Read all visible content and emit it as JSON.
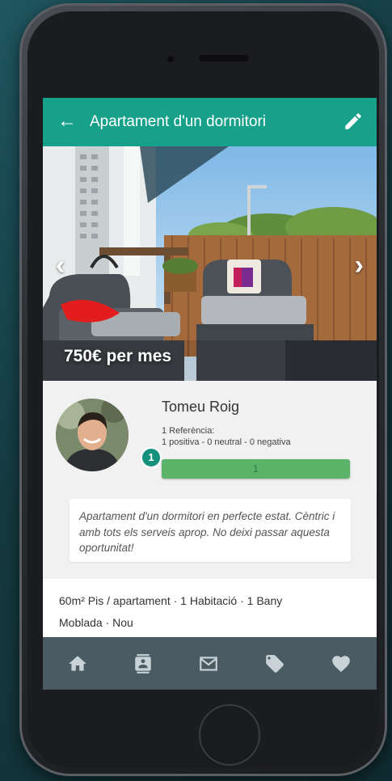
{
  "app_bar": {
    "back_icon": "arrow-left-icon",
    "title": "Apartament d'un dormitori",
    "edit_icon": "pencil-icon"
  },
  "listing": {
    "price": "750€ per mes",
    "prev_icon": "chevron-left-icon",
    "next_icon": "chevron-right-icon"
  },
  "owner": {
    "name": "Tomeu Roig",
    "badge": "1",
    "references_label": "1 Referència:",
    "references_detail": "1 positiva  - 0 neutral  - 0 negativa",
    "rating_bar_label": "1",
    "rating_bar_fill": 1.0
  },
  "description": "Apartament d'un dormitori en perfecte estat. Cèntric i amb tots els serveis aprop. No deixi passar aquesta oportunitat!",
  "features": {
    "line1": "60m² Pis / apartament · 1 Habitació · 1 Bany",
    "line2": "Moblada · Nou"
  },
  "bottom_nav": {
    "items": [
      {
        "icon": "home-icon"
      },
      {
        "icon": "contacts-icon"
      },
      {
        "icon": "mail-icon"
      },
      {
        "icon": "tag-icon"
      },
      {
        "icon": "heart-icon"
      }
    ]
  },
  "colors": {
    "accent": "#17a08a",
    "bar_green": "#5cb46a",
    "nav_bg": "#4b5b63",
    "nav_icon": "#c9d3d7"
  }
}
